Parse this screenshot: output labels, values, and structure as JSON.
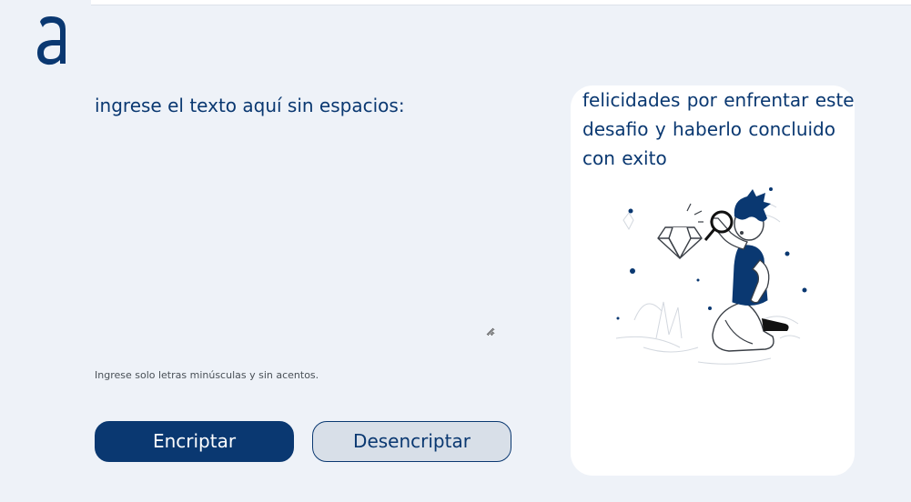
{
  "app": {
    "logo_letter": "a",
    "brand_color": "#0a3871"
  },
  "input": {
    "placeholder": "ingrese el texto aquí sin espacios:",
    "value": ""
  },
  "hint": {
    "text": "Ingrese solo letras minúsculas y sin acentos."
  },
  "buttons": {
    "encrypt_label": "Encriptar",
    "decrypt_label": "Desencriptar"
  },
  "output": {
    "message": "felicidades por enfrentar este desafio y haberlo concluido con exito",
    "illustration_icon": "person-magnifying-diamond-illustration"
  }
}
